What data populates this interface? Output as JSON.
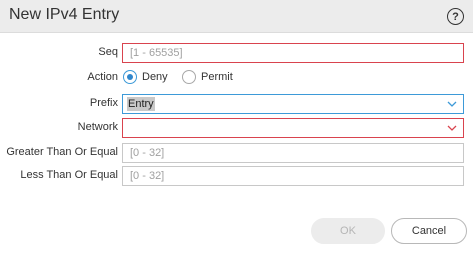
{
  "dialog": {
    "title": "New IPv4 Entry",
    "help_symbol": "?"
  },
  "form": {
    "seq": {
      "label": "Seq",
      "placeholder": "[1 - 65535]",
      "value": ""
    },
    "action": {
      "label": "Action",
      "options": [
        {
          "label": "Deny",
          "selected": true
        },
        {
          "label": "Permit",
          "selected": false
        }
      ]
    },
    "prefix": {
      "label": "Prefix",
      "value": "Entry",
      "icon": "chevron-down-icon"
    },
    "network": {
      "label": "Network",
      "value": "",
      "icon": "chevron-down-icon"
    },
    "greater_than_or_equal": {
      "label": "Greater Than Or Equal",
      "placeholder": "[0 - 32]",
      "value": ""
    },
    "less_than_or_equal": {
      "label": "Less Than Or Equal",
      "placeholder": "[0 - 32]",
      "value": ""
    }
  },
  "buttons": {
    "ok_label": "OK",
    "cancel_label": "Cancel"
  },
  "colors": {
    "invalid_border": "#d9434e",
    "focus_border": "#3d9ad8",
    "radio_selected": "#2f86cc",
    "chevron_focus": "#3d9ad8",
    "chevron_invalid": "#d9434e"
  }
}
